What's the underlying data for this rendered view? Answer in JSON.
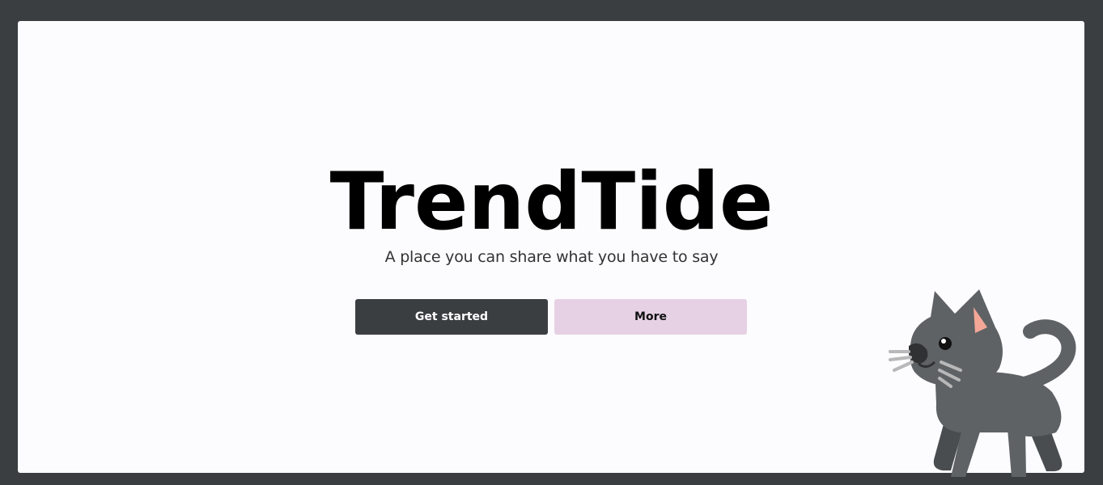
{
  "hero": {
    "title": "TrendTide",
    "subtitle": "A place you can share what you have to say"
  },
  "actions": {
    "primary_label": "Get started",
    "secondary_label": "More"
  },
  "colors": {
    "page_background": "#3b3e41",
    "card_background": "#fcfbfd",
    "primary_button": "#3b3e41",
    "secondary_button": "#e6d1e4"
  },
  "mascot": {
    "icon": "cat-icon"
  }
}
